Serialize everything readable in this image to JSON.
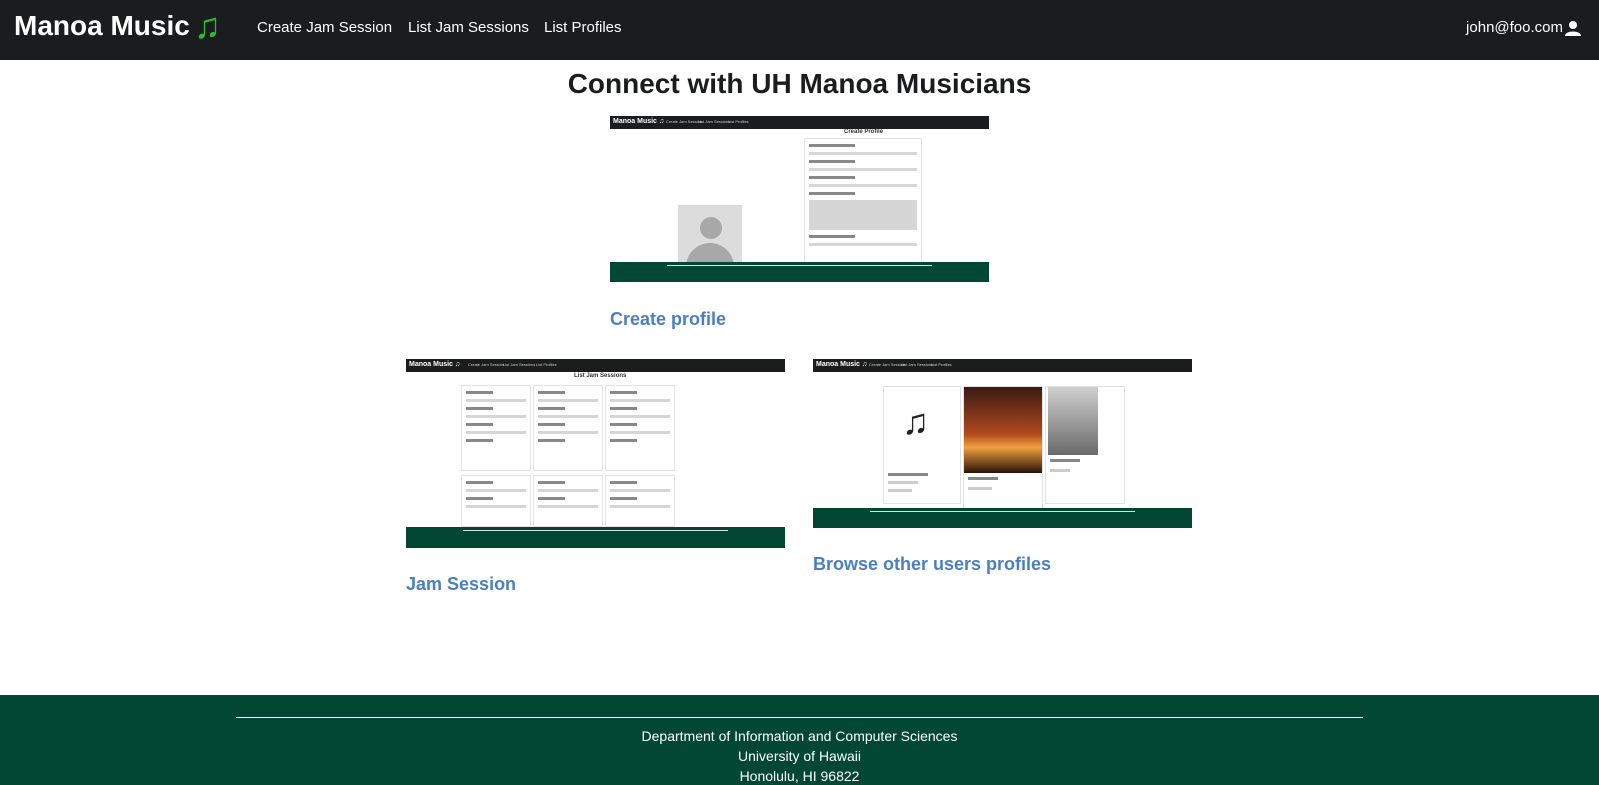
{
  "navbar": {
    "brand": "Manoa Music",
    "links": [
      "Create Jam Session",
      "List Jam Sessions",
      "List Profiles"
    ],
    "user": "john@foo.com"
  },
  "main": {
    "title": "Connect with UH Manoa Musicians",
    "cards": [
      {
        "label": "Create profile",
        "screenshot_title": "Create Profile"
      },
      {
        "label": "Jam Session",
        "screenshot_title": "List Jam Sessions"
      },
      {
        "label": "Browse other users profiles"
      }
    ]
  },
  "footer": {
    "line1": "Department of Information and Computer Sciences",
    "line2": "University of Hawaii",
    "line3": "Honolulu, HI 96822"
  },
  "colors": {
    "navbar": "#1b1c1d",
    "footer": "#024731",
    "link": "#4a7fc1",
    "note": "#2eb82e"
  },
  "icons": [
    "music-note-icon",
    "user-icon"
  ]
}
